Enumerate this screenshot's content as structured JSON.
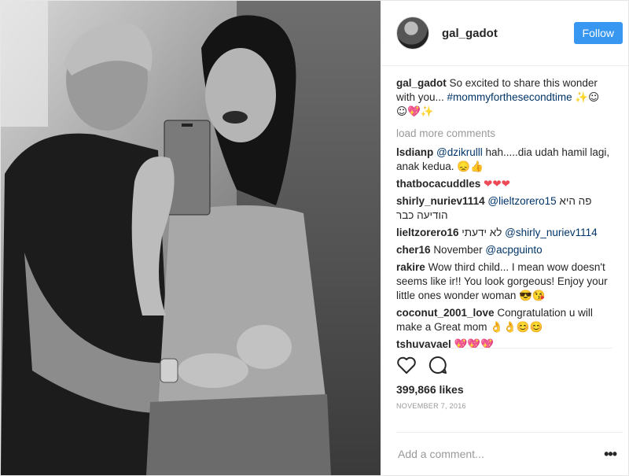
{
  "header": {
    "username": "gal_gadot",
    "follow_label": "Follow"
  },
  "caption": {
    "user": "gal_gadot",
    "text": "So excited to share this wonder with you...",
    "hashtag": "#mommyforthesecondtime",
    "emoji": "✨☺ ☺💖✨"
  },
  "load_more": "load more comments",
  "comments": [
    {
      "user": "lsdianp",
      "mention": "@dzikrulll",
      "text": "hah.....dia udah hamil lagi, anak kedua. 😞👍"
    },
    {
      "user": "thatbocacuddles",
      "mention": "",
      "text": "❤❤❤"
    },
    {
      "user": "shirly_nuriev1114",
      "mention": "@lieltzorero15",
      "text": "פה היא הודיעה כבר"
    },
    {
      "user": "lieltzorero16",
      "mention": "@shirly_nuriev1114",
      "text": "לא ידעתי"
    },
    {
      "user": "cher16",
      "mention": "@acpguinto",
      "text": "November"
    },
    {
      "user": "rakire",
      "mention": "",
      "text": "Wow third child... I mean wow doesn't seems like ir!! You look gorgeous! Enjoy your little ones wonder woman 😎😘"
    },
    {
      "user": "coconut_2001_love",
      "mention": "",
      "text": "Congratulation u will make a Great mom 👌👌😊😊"
    },
    {
      "user": "tshuvayael",
      "mention": "",
      "text": "💖💖💖"
    }
  ],
  "likes": "399,866 likes",
  "date": "NOVEMBER 7, 2016",
  "add_comment_placeholder": "Add a comment...",
  "more_label": "•••",
  "icons": {
    "like": "heart-outline-icon",
    "comment": "comment-bubble-icon",
    "options": "more-options-icon"
  }
}
